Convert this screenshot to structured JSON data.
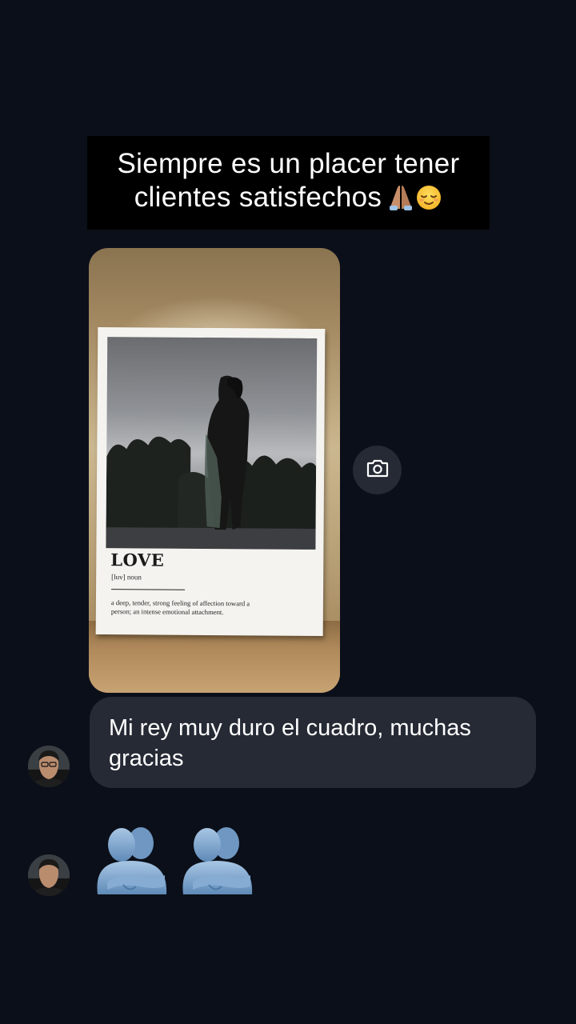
{
  "caption": {
    "line1": "Siempre es un placer tener",
    "line2": "clientes satisfechos",
    "emojis": [
      "folded-hands-emoji",
      "relieved-face-emoji"
    ]
  },
  "shared_photo": {
    "poster_title": "LOVE",
    "poster_phonetic": "[luv] noun",
    "poster_definition": "a deep, tender, strong feeling of affection toward a person; an intense emotional attachment."
  },
  "camera_button": {
    "icon": "camera-icon"
  },
  "messages": [
    {
      "sender": "contact",
      "avatar": "avatar-icon",
      "text": "Mi rey muy duro el cuadro, muchas gracias"
    },
    {
      "sender": "contact",
      "avatar": "avatar-icon",
      "emojis": [
        "people-hugging-emoji",
        "people-hugging-emoji"
      ]
    }
  ],
  "colors": {
    "background": "#0b0f19",
    "bubble": "#262a35",
    "caption_bg": "#000000",
    "text": "#ffffff",
    "hug_emoji": "#7fa6cc"
  }
}
